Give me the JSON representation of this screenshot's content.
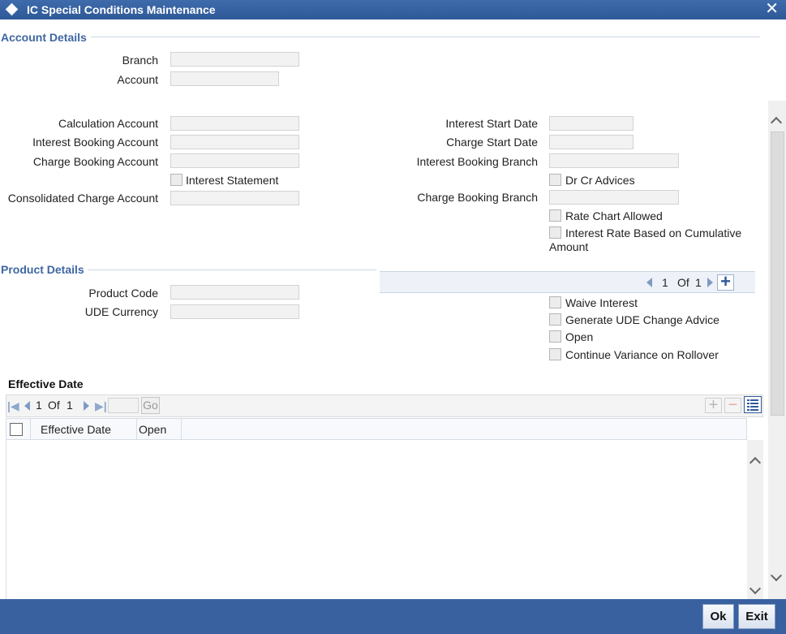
{
  "window": {
    "title": "IC Special Conditions Maintenance"
  },
  "account_details": {
    "title": "Account Details",
    "branch_label": "Branch",
    "account_label": "Account",
    "calculation_account_label": "Calculation Account",
    "interest_booking_account_label": "Interest Booking Account",
    "charge_booking_account_label": "Charge Booking Account",
    "interest_statement_label": "Interest Statement",
    "consolidated_charge_account_label": "Consolidated Charge Account",
    "interest_start_date_label": "Interest Start Date",
    "charge_start_date_label": "Charge Start Date",
    "interest_booking_branch_label": "Interest Booking Branch",
    "dr_cr_advices_label": "Dr Cr Advices",
    "charge_booking_branch_label": "Charge Booking Branch",
    "rate_chart_allowed_label": "Rate Chart Allowed",
    "interest_rate_cumulative_label_line1": "Interest Rate Based on Cumulative",
    "interest_rate_cumulative_label_line2": "Amount"
  },
  "product_details": {
    "title": "Product Details",
    "product_code_label": "Product Code",
    "ude_currency_label": "UDE Currency",
    "pager": {
      "current": "1",
      "of_label": "Of",
      "total": "1"
    },
    "waive_interest_label": "Waive Interest",
    "generate_ude_change_advice_label": "Generate UDE Change Advice",
    "open_label": "Open",
    "continue_variance_label": "Continue Variance on Rollover"
  },
  "effective_date": {
    "title": "Effective Date",
    "pager": {
      "current": "1",
      "of_label": "Of",
      "total": "1",
      "go_label": "Go"
    },
    "columns": [
      "Effective Date",
      "Open"
    ]
  },
  "footer": {
    "ok_label": "Ok",
    "exit_label": "Exit"
  },
  "colors": {
    "titlebar": "#2f5998",
    "section": "#3e67a3",
    "footer": "#3961a0"
  }
}
